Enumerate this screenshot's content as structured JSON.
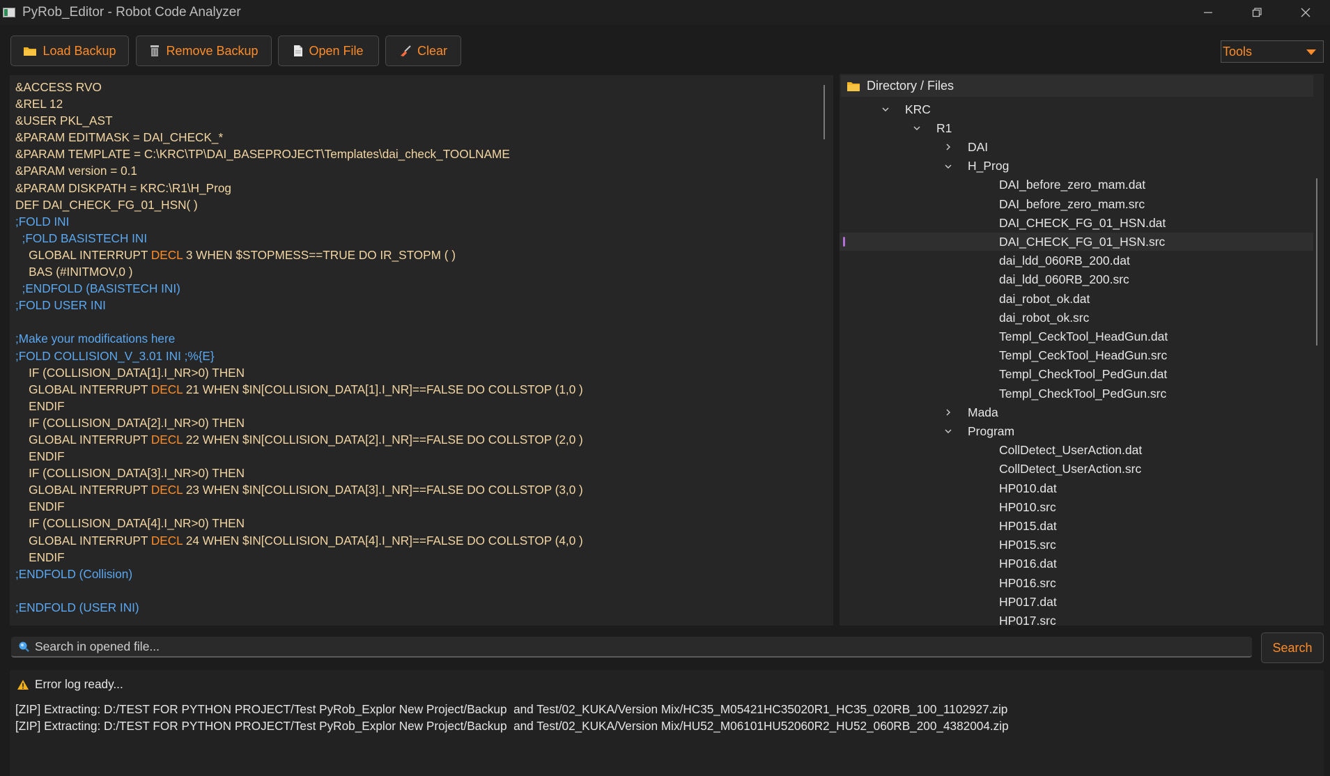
{
  "window": {
    "title": "PyRob_Editor - Robot Code Analyzer"
  },
  "toolbar": {
    "load_backup": "Load Backup",
    "remove_backup": "Remove Backup",
    "open_file": "Open File",
    "clear": "Clear",
    "tools_value": "Tools"
  },
  "colors": {
    "accent": "#ff8c28",
    "comment": "#5aa8f2",
    "code_text": "#f3d6a2",
    "selection_marker": "#b26fd8"
  },
  "editor": {
    "lines": [
      [
        {
          "t": "&ACCESS RVO",
          "c": ""
        }
      ],
      [
        {
          "t": "&REL 12",
          "c": ""
        }
      ],
      [
        {
          "t": "&USER PKL_AST",
          "c": ""
        }
      ],
      [
        {
          "t": "&PARAM EDITMASK = DAI_CHECK_*",
          "c": ""
        }
      ],
      [
        {
          "t": "&PARAM TEMPLATE = C:\\KRC\\TP\\DAI_BASEPROJECT\\Templates\\dai_check_TOOLNAME",
          "c": ""
        }
      ],
      [
        {
          "t": "&PARAM version = 0.1",
          "c": ""
        }
      ],
      [
        {
          "t": "&PARAM DISKPATH = KRC:\\R1\\H_Prog",
          "c": ""
        }
      ],
      [
        {
          "t": "DEF DAI_CHECK_FG_01_HSN( )",
          "c": ""
        }
      ],
      [
        {
          "t": ";FOLD INI",
          "c": "comment"
        }
      ],
      [
        {
          "t": "  ;FOLD BASISTECH INI",
          "c": "comment"
        }
      ],
      [
        {
          "t": "    GLOBAL INTERRUPT ",
          "c": ""
        },
        {
          "t": "DECL",
          "c": "kw"
        },
        {
          "t": " 3 WHEN $STOPMESS==TRUE DO IR_STOPM ( )",
          "c": ""
        }
      ],
      [
        {
          "t": "    BAS (#INITMOV,0 )",
          "c": ""
        }
      ],
      [
        {
          "t": "  ;ENDFOLD (BASISTECH INI)",
          "c": "comment"
        }
      ],
      [
        {
          "t": ";FOLD USER INI",
          "c": "comment"
        }
      ],
      [
        {
          "t": "",
          "c": ""
        }
      ],
      [
        {
          "t": ";Make your modifications here",
          "c": "comment"
        }
      ],
      [
        {
          "t": ";FOLD COLLISION_V_3.01 INI ;%{E}",
          "c": "comment"
        }
      ],
      [
        {
          "t": "    IF (COLLISION_DATA[1].I_NR>0) THEN",
          "c": ""
        }
      ],
      [
        {
          "t": "    GLOBAL INTERRUPT ",
          "c": ""
        },
        {
          "t": "DECL",
          "c": "kw"
        },
        {
          "t": " 21 WHEN $IN[COLLISION_DATA[1].I_NR]==FALSE DO COLLSTOP (1,0 )",
          "c": ""
        }
      ],
      [
        {
          "t": "    ENDIF",
          "c": ""
        }
      ],
      [
        {
          "t": "    IF (COLLISION_DATA[2].I_NR>0) THEN",
          "c": ""
        }
      ],
      [
        {
          "t": "    GLOBAL INTERRUPT ",
          "c": ""
        },
        {
          "t": "DECL",
          "c": "kw"
        },
        {
          "t": " 22 WHEN $IN[COLLISION_DATA[2].I_NR]==FALSE DO COLLSTOP (2,0 )",
          "c": ""
        }
      ],
      [
        {
          "t": "    ENDIF",
          "c": ""
        }
      ],
      [
        {
          "t": "    IF (COLLISION_DATA[3].I_NR>0) THEN",
          "c": ""
        }
      ],
      [
        {
          "t": "    GLOBAL INTERRUPT ",
          "c": ""
        },
        {
          "t": "DECL",
          "c": "kw"
        },
        {
          "t": " 23 WHEN $IN[COLLISION_DATA[3].I_NR]==FALSE DO COLLSTOP (3,0 )",
          "c": ""
        }
      ],
      [
        {
          "t": "    ENDIF",
          "c": ""
        }
      ],
      [
        {
          "t": "    IF (COLLISION_DATA[4].I_NR>0) THEN",
          "c": ""
        }
      ],
      [
        {
          "t": "    GLOBAL INTERRUPT ",
          "c": ""
        },
        {
          "t": "DECL",
          "c": "kw"
        },
        {
          "t": " 24 WHEN $IN[COLLISION_DATA[4].I_NR]==FALSE DO COLLSTOP (4,0 )",
          "c": ""
        }
      ],
      [
        {
          "t": "    ENDIF",
          "c": ""
        }
      ],
      [
        {
          "t": ";ENDFOLD (Collision)",
          "c": "comment"
        }
      ],
      [
        {
          "t": "",
          "c": ""
        }
      ],
      [
        {
          "t": ";ENDFOLD (USER INI)",
          "c": "comment"
        }
      ]
    ]
  },
  "tree": {
    "header": "Directory / Files",
    "items": [
      {
        "label": "KRC",
        "depth": 0,
        "chevron": "down"
      },
      {
        "label": "R1",
        "depth": 1,
        "chevron": "down"
      },
      {
        "label": "DAI",
        "depth": 2,
        "chevron": "right"
      },
      {
        "label": "H_Prog",
        "depth": 2,
        "chevron": "down"
      },
      {
        "label": "DAI_before_zero_mam.dat",
        "depth": 3,
        "chevron": ""
      },
      {
        "label": "DAI_before_zero_mam.src",
        "depth": 3,
        "chevron": ""
      },
      {
        "label": "DAI_CHECK_FG_01_HSN.dat",
        "depth": 3,
        "chevron": ""
      },
      {
        "label": "DAI_CHECK_FG_01_HSN.src",
        "depth": 3,
        "chevron": "",
        "selected": true
      },
      {
        "label": "dai_ldd_060RB_200.dat",
        "depth": 3,
        "chevron": ""
      },
      {
        "label": "dai_ldd_060RB_200.src",
        "depth": 3,
        "chevron": ""
      },
      {
        "label": "dai_robot_ok.dat",
        "depth": 3,
        "chevron": ""
      },
      {
        "label": "dai_robot_ok.src",
        "depth": 3,
        "chevron": ""
      },
      {
        "label": "Templ_CeckTool_HeadGun.dat",
        "depth": 3,
        "chevron": ""
      },
      {
        "label": "Templ_CeckTool_HeadGun.src",
        "depth": 3,
        "chevron": ""
      },
      {
        "label": "Templ_CheckTool_PedGun.dat",
        "depth": 3,
        "chevron": ""
      },
      {
        "label": "Templ_CheckTool_PedGun.src",
        "depth": 3,
        "chevron": ""
      },
      {
        "label": "Mada",
        "depth": 2,
        "chevron": "right"
      },
      {
        "label": "Program",
        "depth": 2,
        "chevron": "down"
      },
      {
        "label": "CollDetect_UserAction.dat",
        "depth": 3,
        "chevron": ""
      },
      {
        "label": "CollDetect_UserAction.src",
        "depth": 3,
        "chevron": ""
      },
      {
        "label": "HP010.dat",
        "depth": 3,
        "chevron": ""
      },
      {
        "label": "HP010.src",
        "depth": 3,
        "chevron": ""
      },
      {
        "label": "HP015.dat",
        "depth": 3,
        "chevron": ""
      },
      {
        "label": "HP015.src",
        "depth": 3,
        "chevron": ""
      },
      {
        "label": "HP016.dat",
        "depth": 3,
        "chevron": ""
      },
      {
        "label": "HP016.src",
        "depth": 3,
        "chevron": ""
      },
      {
        "label": "HP017.dat",
        "depth": 3,
        "chevron": ""
      },
      {
        "label": "HP017.src",
        "depth": 3,
        "chevron": ""
      }
    ]
  },
  "search": {
    "placeholder": "Search in opened file...",
    "button": "Search"
  },
  "log": {
    "ready": "Error log ready...",
    "lines": [
      "[ZIP] Extracting: D:/TEST FOR PYTHON PROJECT/Test PyRob_Explor New Project/Backup  and Test/02_KUKA/Version Mix/HC35_M05421HC35020R1_HC35_020RB_100_1102927.zip",
      "[ZIP] Extracting: D:/TEST FOR PYTHON PROJECT/Test PyRob_Explor New Project/Backup  and Test/02_KUKA/Version Mix/HU52_M06101HU52060R2_HU52_060RB_200_4382004.zip"
    ]
  }
}
